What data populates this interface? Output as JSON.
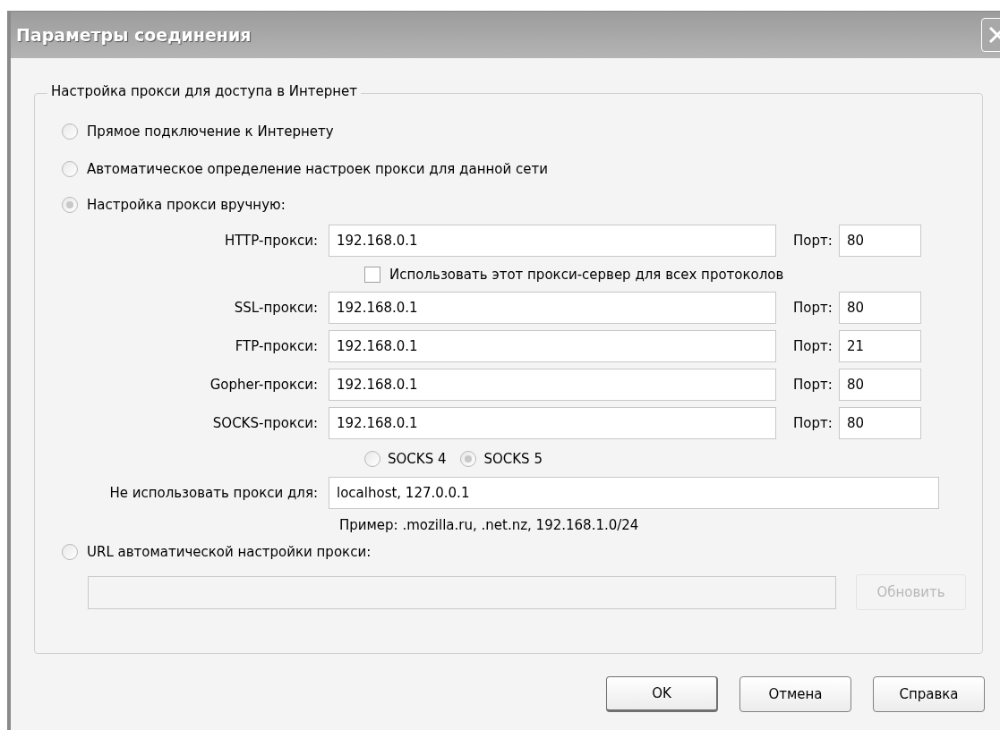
{
  "window": {
    "title": "Параметры соединения"
  },
  "group": {
    "legend": "Настройка прокси для доступа в Интернет"
  },
  "modes": [
    {
      "label": "Прямое подключение к Интернету",
      "selected": false
    },
    {
      "label": "Автоматическое определение настроек прокси для данной сети",
      "selected": false
    },
    {
      "label": "Настройка прокси вручную:",
      "selected": true
    },
    {
      "label": "URL автоматической настройки прокси:",
      "selected": false
    }
  ],
  "proxies": [
    {
      "label": "HTTP-прокси:",
      "value": "192.168.0.1",
      "port_label": "Порт:",
      "port": "80"
    },
    {
      "label": "SSL-прокси:",
      "value": "192.168.0.1",
      "port_label": "Порт:",
      "port": "80"
    },
    {
      "label": "FTP-прокси:",
      "value": "192.168.0.1",
      "port_label": "Порт:",
      "port": "21"
    },
    {
      "label": "Gopher-прокси:",
      "value": "192.168.0.1",
      "port_label": "Порт:",
      "port": "80"
    },
    {
      "label": "SOCKS-прокси:",
      "value": "192.168.0.1",
      "port_label": "Порт:",
      "port": "80"
    }
  ],
  "share_all": {
    "label": "Использовать этот прокси-сервер для всех протоколов",
    "checked": false
  },
  "socks_versions": [
    {
      "label": "SOCKS 4",
      "selected": false
    },
    {
      "label": "SOCKS 5",
      "selected": true
    }
  ],
  "no_proxy": {
    "label": "Не использовать прокси для:",
    "value": "localhost, 127.0.0.1",
    "example": "Пример: .mozilla.ru, .net.nz, 192.168.1.0/24"
  },
  "auto_url": {
    "disabled": true
  },
  "reload_button": {
    "label": "Обновить",
    "disabled": true
  },
  "buttons": [
    {
      "label": "OK",
      "default": true
    },
    {
      "label": "Отмена",
      "default": false
    },
    {
      "label": "Справка",
      "default": false
    }
  ]
}
